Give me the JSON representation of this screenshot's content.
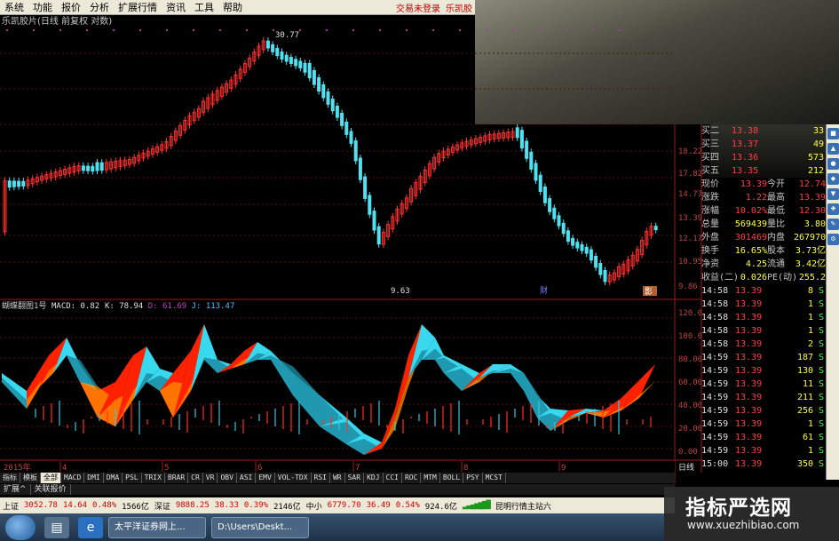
{
  "menu": {
    "items": [
      "系统",
      "功能",
      "报价",
      "分析",
      "扩展行情",
      "资讯",
      "工具",
      "帮助"
    ],
    "right": [
      "交易未登录",
      "乐凯胶"
    ]
  },
  "chart_title": "乐凯胶片(日线 前复权 对数)",
  "price_chart": {
    "high_label": "30.77",
    "low_label": "9.63",
    "y_ticks": [
      "18.22",
      "17.82",
      "14.77",
      "13.39",
      "12.17",
      "10.95",
      "9.86"
    ],
    "markers": [
      "财",
      "影"
    ]
  },
  "indicator": {
    "title": "蝴蝶翻图1号",
    "values": [
      {
        "label": "MACD: 0.82",
        "color": "#e0e0e0"
      },
      {
        "label": "K: 78.94",
        "color": "#e0e0e0"
      },
      {
        "label": "D: 61.69",
        "color": "#c040c0"
      },
      {
        "label": "J: 113.47",
        "color": "#40c0ff"
      }
    ],
    "y_ticks": [
      "120.0",
      "100.0",
      "80.00",
      "60.00",
      "40.00",
      "20.00",
      "0.00"
    ]
  },
  "time_axis": {
    "year": "2015年",
    "months": [
      "4",
      "5",
      "6",
      "7",
      "8",
      "9"
    ],
    "period": "日线"
  },
  "quote": {
    "levels": [
      {
        "name": "买二",
        "price": "13.38",
        "vol": "33"
      },
      {
        "name": "买三",
        "price": "13.37",
        "vol": "49"
      },
      {
        "name": "买四",
        "price": "13.36",
        "vol": "573"
      },
      {
        "name": "买五",
        "price": "13.35",
        "vol": "212"
      }
    ],
    "stats": [
      {
        "k1": "现价",
        "v1": "13.39",
        "k2": "今开",
        "v2": "12.74"
      },
      {
        "k1": "涨跌",
        "v1": "1.22",
        "k2": "最高",
        "v2": "13.39"
      },
      {
        "k1": "涨幅",
        "v1": "10.02%",
        "k2": "最低",
        "v2": "12.30"
      },
      {
        "k1": "总量",
        "v1": "569439",
        "k2": "量比",
        "v2": "3.80"
      },
      {
        "k1": "外盘",
        "v1": "301469",
        "k2": "内盘",
        "v2": "267970"
      },
      {
        "k1": "换手",
        "v1": "16.65%",
        "k2": "股本",
        "v2": "3.73亿"
      },
      {
        "k1": "净资",
        "v1": "4.25",
        "k2": "流通",
        "v2": "3.42亿"
      },
      {
        "k1": "收益(二)",
        "v1": "0.026",
        "k2": "PE(动)",
        "v2": "255.2"
      }
    ],
    "ticks": [
      {
        "t": "14:58",
        "p": "13.39",
        "v": "8",
        "s": "S"
      },
      {
        "t": "14:58",
        "p": "13.39",
        "v": "1",
        "s": "S"
      },
      {
        "t": "14:58",
        "p": "13.39",
        "v": "1",
        "s": "S"
      },
      {
        "t": "14:58",
        "p": "13.39",
        "v": "1",
        "s": "S"
      },
      {
        "t": "14:58",
        "p": "13.39",
        "v": "2",
        "s": "S"
      },
      {
        "t": "14:59",
        "p": "13.39",
        "v": "187",
        "s": "S"
      },
      {
        "t": "14:59",
        "p": "13.39",
        "v": "130",
        "s": "S"
      },
      {
        "t": "14:59",
        "p": "13.39",
        "v": "11",
        "s": "S"
      },
      {
        "t": "14:59",
        "p": "13.39",
        "v": "211",
        "s": "S"
      },
      {
        "t": "14:59",
        "p": "13.39",
        "v": "256",
        "s": "S"
      },
      {
        "t": "14:59",
        "p": "13.39",
        "v": "1",
        "s": "S"
      },
      {
        "t": "14:59",
        "p": "13.39",
        "v": "61",
        "s": "S"
      },
      {
        "t": "14:59",
        "p": "13.39",
        "v": "1",
        "s": "S"
      },
      {
        "t": "15:00",
        "p": "13.39",
        "v": "350",
        "s": "S"
      }
    ]
  },
  "indicator_tabs": [
    "指标",
    "模板",
    "全部",
    "MACD",
    "DMI",
    "DMA",
    "PSL",
    "TRIX",
    "BRAR",
    "CR",
    "VR",
    "OBV",
    "ASI",
    "EMV",
    "VOL-TDX",
    "RSI",
    "WR",
    "SAR",
    "KDJ",
    "CCI",
    "ROC",
    "MTM",
    "BOLL",
    "PSY",
    "MCST"
  ],
  "bottom_tabs": [
    "扩展^",
    "关联报价"
  ],
  "status": {
    "sh_label": "上证",
    "sh_val": "3052.78",
    "sh_chg": "14.64",
    "sh_pct": "0.48%",
    "sh_amt": "1566亿",
    "sz_label": "深证",
    "sz_val": "9888.25",
    "sz_chg": "38.33",
    "sz_pct": "0.39%",
    "sz_amt": "2146亿",
    "zx_label": "中小",
    "zx_val": "6779.70",
    "zx_chg": "36.49",
    "zx_pct": "0.54%",
    "zx_amt": "924.6亿",
    "server": "昆明行情主站六"
  },
  "taskbar": {
    "task1": "太平洋证券网上...",
    "task2": "D:\\Users\\Deskt..."
  },
  "watermark": {
    "title": "指标严选网",
    "url": "www.xuezhibiao.com"
  },
  "colors": {
    "up": "#ff3030",
    "down": "#50e0f0",
    "bull_area": "#ff2200",
    "bull_area2": "#ff8800",
    "bear_area": "#38d8ee",
    "bear_area2": "#1a8aa0"
  }
}
